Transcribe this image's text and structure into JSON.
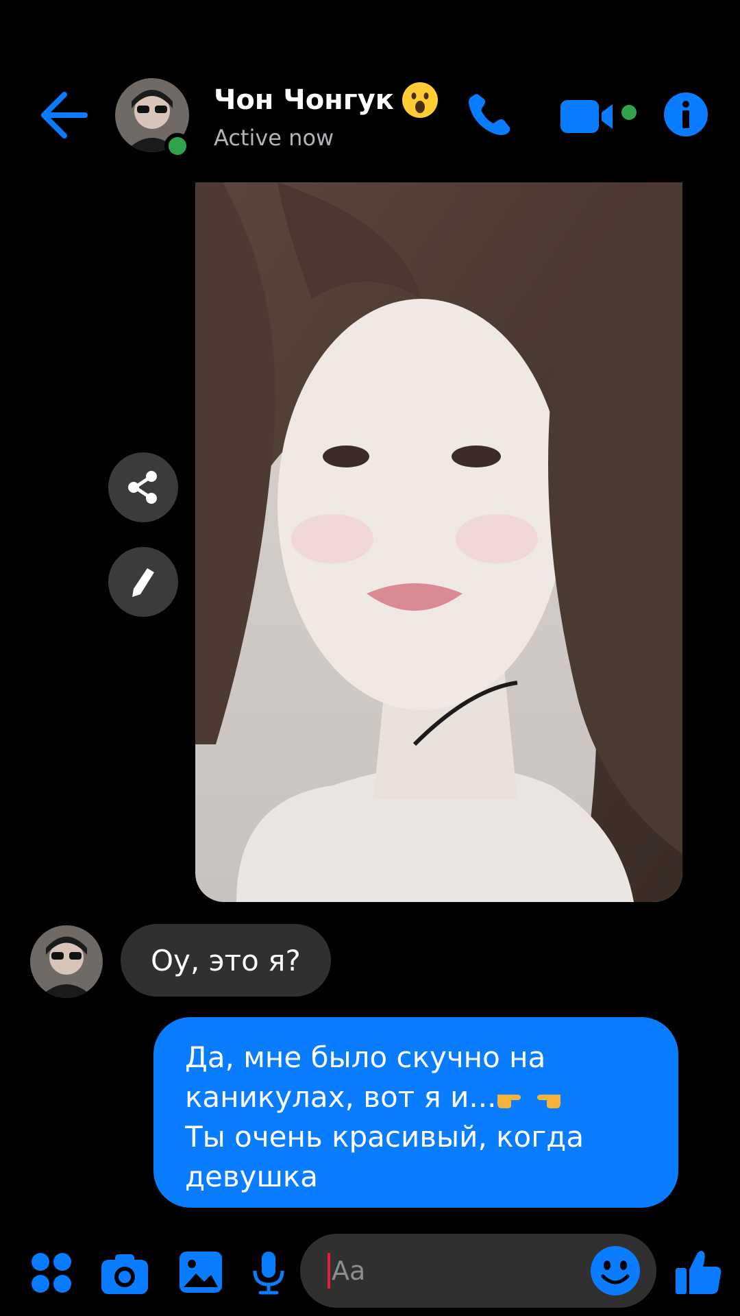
{
  "theme": {
    "accent": "#0a7cff",
    "background": "#000000",
    "incoming_bubble": "#303030",
    "presence": "#31a24c"
  },
  "header": {
    "back_icon": "arrow-left-icon",
    "contact_name": "Чон Чонгук",
    "name_emoji": "astonished-face-emoji",
    "status": "Active now",
    "actions": [
      "phone-icon",
      "video-camera-icon",
      "info-icon"
    ]
  },
  "conversation": {
    "photo_message": {
      "side_actions": [
        "share-icon",
        "edit-pencil-icon"
      ]
    },
    "incoming": {
      "text": "Оу, это я?"
    },
    "outgoing": {
      "line1": "Да, мне было скучно на",
      "line2": "каникулах, вот я и...",
      "line2_emoji": "pointing-hands-emoji",
      "line3": "Ты очень красивый, когда",
      "line4": "девушка"
    }
  },
  "composer": {
    "placeholder": "Aa",
    "buttons": [
      "apps-icon",
      "camera-icon",
      "gallery-icon",
      "microphone-icon",
      "emoji-icon",
      "thumbs-up-icon"
    ]
  }
}
